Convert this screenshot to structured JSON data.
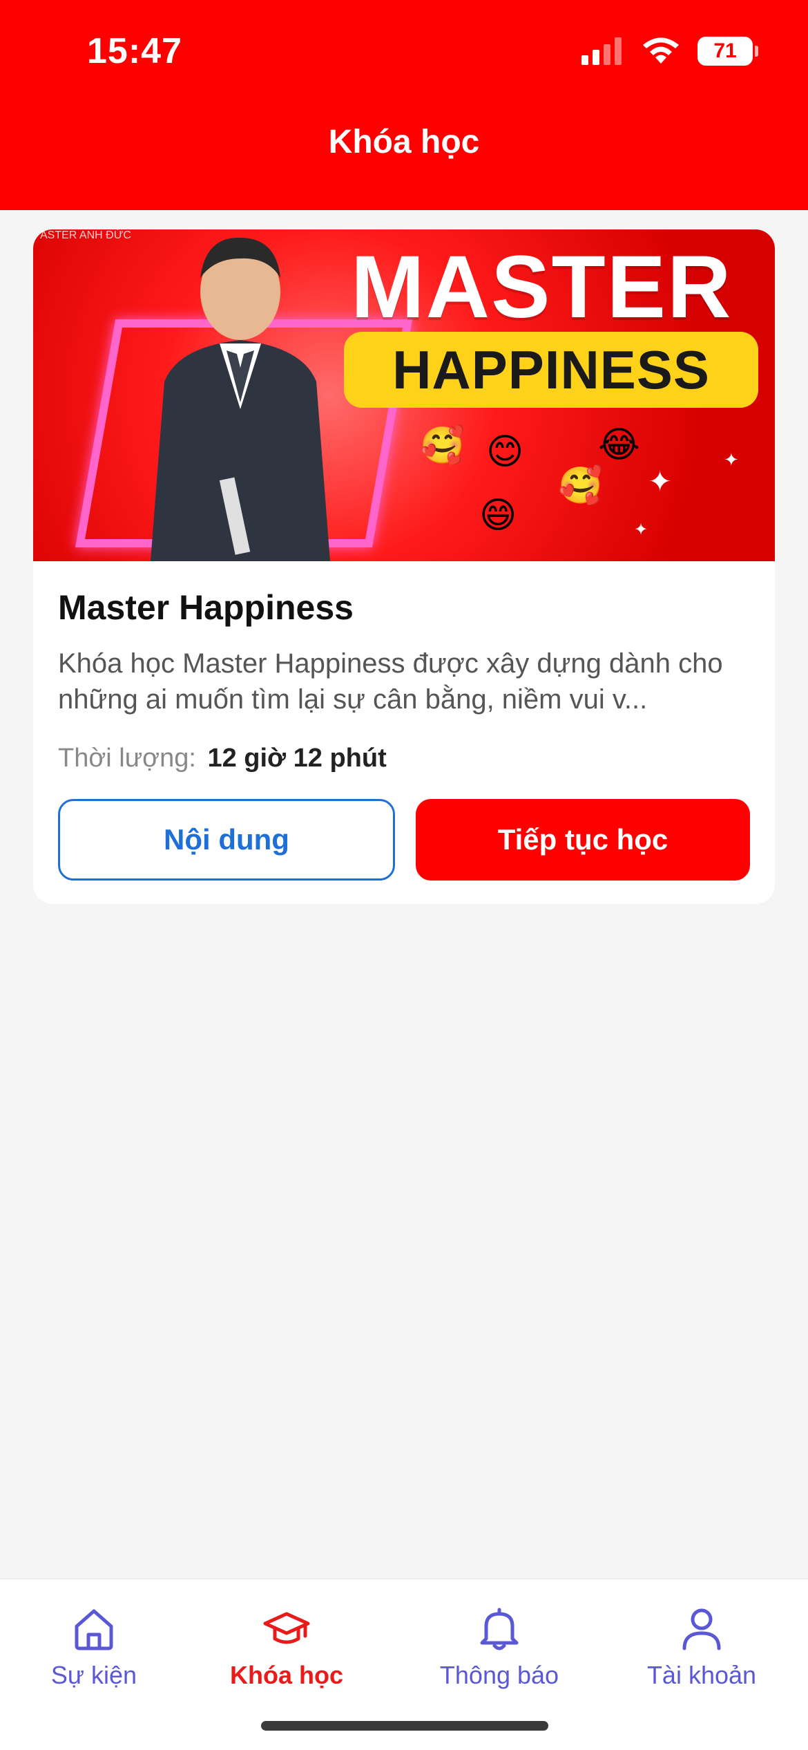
{
  "status_bar": {
    "time": "15:47",
    "battery": "71",
    "signal_icon": "cellular-signal-icon",
    "wifi_icon": "wifi-icon"
  },
  "header": {
    "title": "Khóa học"
  },
  "course": {
    "banner": {
      "headline": "MASTER",
      "subheadline": "HAPPINESS",
      "small_brand": "ASTER ANH ĐỨC",
      "emojis": [
        "🥰",
        "😊",
        "😂",
        "🥰",
        "😄"
      ]
    },
    "title": "Master Happiness",
    "description": "Khóa học Master Happiness được xây dựng dành cho những ai muốn tìm lại sự cân bằng, niềm vui v...",
    "duration_label": "Thời lượng:",
    "duration_value": "12 giờ 12 phút",
    "content_button": "Nội dung",
    "continue_button": "Tiếp tục học"
  },
  "bottom_nav": {
    "items": [
      {
        "label": "Sự kiện",
        "icon": "home-icon"
      },
      {
        "label": "Khóa học",
        "icon": "graduation-cap-icon",
        "active": true
      },
      {
        "label": "Thông báo",
        "icon": "bell-icon"
      },
      {
        "label": "Tài khoản",
        "icon": "user-icon"
      }
    ]
  },
  "colors": {
    "brand_red": "#ff0000",
    "nav_inactive": "#5b58d6",
    "nav_active": "#e81a1a",
    "link_blue": "#1f6fd8",
    "banner_yellow": "#ffd21a"
  }
}
